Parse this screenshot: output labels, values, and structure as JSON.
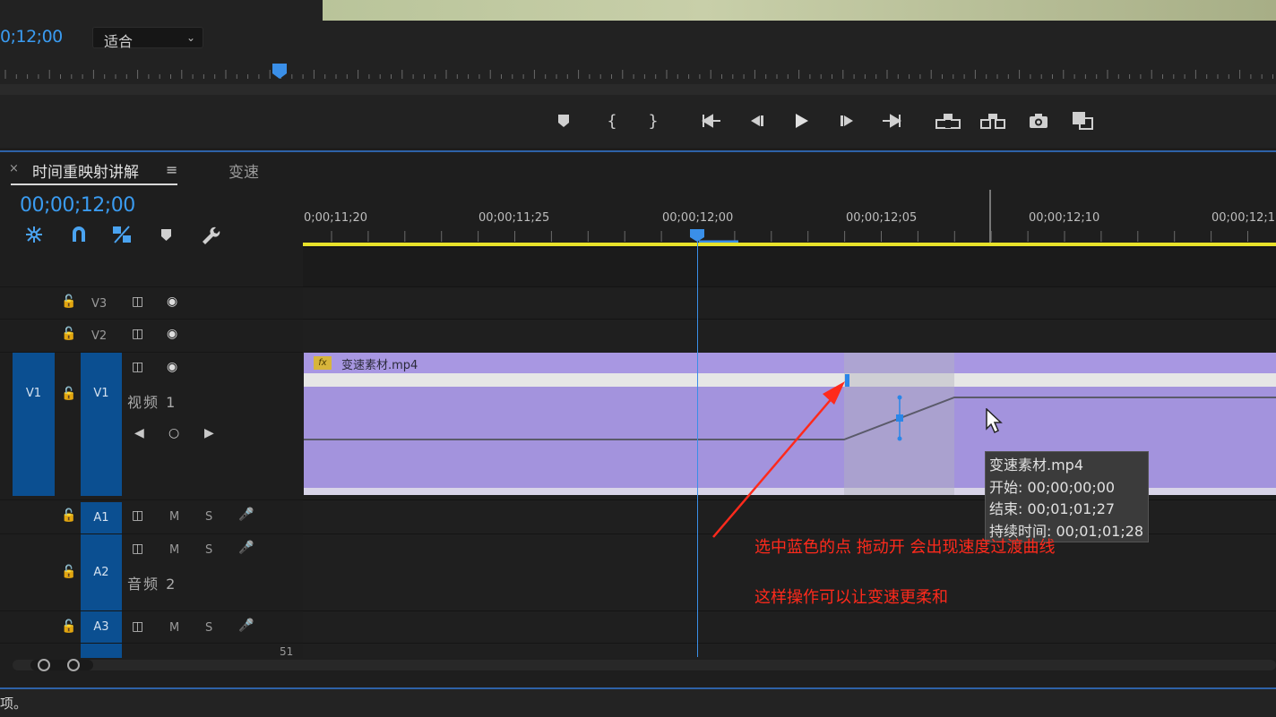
{
  "monitor": {
    "timecode": "0;12;00",
    "fit_select": "适合",
    "transport_icons": [
      "marker-icon",
      "mark-in-icon",
      "mark-out-icon",
      "go-to-in-icon",
      "step-back-icon",
      "play-icon",
      "step-forward-icon",
      "go-to-out-icon",
      "lift-icon",
      "extract-icon",
      "camera-icon",
      "compare-icon"
    ]
  },
  "timeline": {
    "tab_close": "×",
    "tab_name": "时间重映射讲解",
    "tab_menu": "≡",
    "tab_second": "变速",
    "timecode": "00;00;12;00",
    "ruler_labels": [
      "0;00;11;20",
      "00;00;11;25",
      "00;00;12;00",
      "00;00;12;05",
      "00;00;12;10",
      "00;00;12;1"
    ],
    "tracks": {
      "v3": "V3",
      "v2": "V2",
      "v1_source": "V1",
      "v1": "V1",
      "v1_name": "视频 1",
      "a1": "A1",
      "a2": "A2",
      "a2_name": "音频 2",
      "a3": "A3",
      "m": "M",
      "s": "S",
      "extra": "51"
    },
    "clip": {
      "fx": "fx",
      "name": "变速素材.mp4",
      "color": "#a393dd"
    },
    "tooltip": {
      "name": "变速素材.mp4",
      "start": "开始: 00;00;00;00",
      "end": "结束: 00;01;01;27",
      "duration": "持续时间: 00;01;01;28"
    }
  },
  "annotation": {
    "line1": "选中蓝色的点 拖动开 会出现速度过渡曲线",
    "line2": "这样操作可以让变速更柔和",
    "color": "#ff2a1c"
  },
  "status": {
    "text": "项。"
  }
}
